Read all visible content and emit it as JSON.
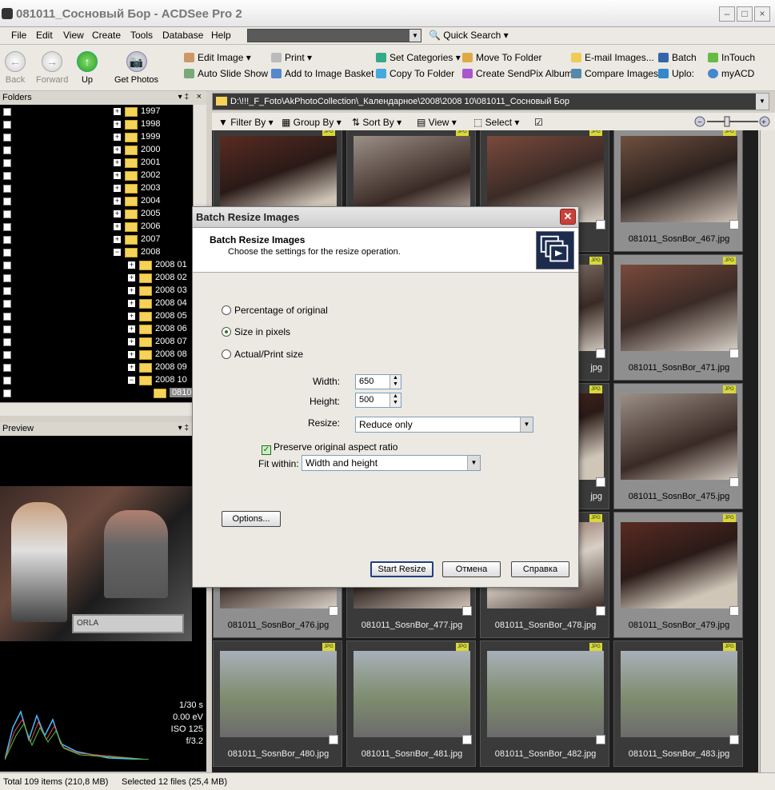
{
  "window": {
    "title": "081011_Сосновый Бор - ACDSee Pro 2"
  },
  "menu": [
    "File",
    "Edit",
    "View",
    "Create",
    "Tools",
    "Database",
    "Help"
  ],
  "quick_search": "Quick Search",
  "toolbar": {
    "back": "Back",
    "forward": "Forward",
    "up": "Up",
    "get_photos": "Get Photos",
    "edit_image": "Edit Image",
    "auto_slide_show": "Auto Slide Show",
    "print": "Print",
    "add_to_basket": "Add to Image Basket",
    "set_categories": "Set Categories",
    "copy_to_folder": "Copy To Folder",
    "move_to_folder": "Move To Folder",
    "sendpix": "Create SendPix Album",
    "email_images": "E-mail Images...",
    "compare_images": "Compare Images",
    "batch": "Batch",
    "upload": "Uplo:",
    "intouch": "InTouch",
    "myacd": "myACD"
  },
  "folders_panel": {
    "title": "Folders",
    "items": [
      {
        "label": "1997",
        "level": 0
      },
      {
        "label": "1998",
        "level": 0
      },
      {
        "label": "1999",
        "level": 0
      },
      {
        "label": "2000",
        "level": 0
      },
      {
        "label": "2001",
        "level": 0
      },
      {
        "label": "2002",
        "level": 0
      },
      {
        "label": "2003",
        "level": 0
      },
      {
        "label": "2004",
        "level": 0
      },
      {
        "label": "2005",
        "level": 0
      },
      {
        "label": "2006",
        "level": 0
      },
      {
        "label": "2007",
        "level": 0
      },
      {
        "label": "2008",
        "level": 0,
        "expanded": true
      },
      {
        "label": "2008 01",
        "level": 1
      },
      {
        "label": "2008 02",
        "level": 1
      },
      {
        "label": "2008 03",
        "level": 1
      },
      {
        "label": "2008 04",
        "level": 1
      },
      {
        "label": "2008 05",
        "level": 1
      },
      {
        "label": "2008 06",
        "level": 1
      },
      {
        "label": "2008 07",
        "level": 1
      },
      {
        "label": "2008 08",
        "level": 1
      },
      {
        "label": "2008 09",
        "level": 1
      },
      {
        "label": "2008 10",
        "level": 1,
        "expanded": true
      },
      {
        "label": "0810",
        "level": 2,
        "selected": true
      }
    ]
  },
  "preview_panel": {
    "title": "Preview",
    "keyboard_label": "ORLA",
    "exif": [
      "1/30 s",
      "0.00 eV",
      "ISO 125",
      "f/3.2"
    ]
  },
  "path": "D:\\!!!_F_Foto\\AkPhotoCollection\\_Календарное\\2008\\2008 10\\081011_Сосновый Бор",
  "subtoolbar": {
    "filter_by": "Filter By",
    "group_by": "Group By",
    "sort_by": "Sort By",
    "view": "View",
    "select": "Select"
  },
  "thumbnails": [
    {
      "caption": "",
      "selected": false
    },
    {
      "caption": "",
      "selected": false
    },
    {
      "caption": "",
      "selected": false
    },
    {
      "caption": "081011_SosnBor_467.jpg",
      "selected": true
    },
    {
      "caption": "",
      "selected": false
    },
    {
      "caption": "",
      "selected": false
    },
    {
      "caption": "jpg",
      "selected": false
    },
    {
      "caption": "081011_SosnBor_471.jpg",
      "selected": true
    },
    {
      "caption": "",
      "selected": false
    },
    {
      "caption": "",
      "selected": false
    },
    {
      "caption": "jpg",
      "selected": false
    },
    {
      "caption": "081011_SosnBor_475.jpg",
      "selected": true
    },
    {
      "caption": "081011_SosnBor_476.jpg",
      "selected": true
    },
    {
      "caption": "081011_SosnBor_477.jpg",
      "selected": false
    },
    {
      "caption": "081011_SosnBor_478.jpg",
      "selected": false
    },
    {
      "caption": "081011_SosnBor_479.jpg",
      "selected": true
    },
    {
      "caption": "081011_SosnBor_480.jpg",
      "selected": false
    },
    {
      "caption": "081011_SosnBor_481.jpg",
      "selected": false
    },
    {
      "caption": "081011_SosnBor_482.jpg",
      "selected": false
    },
    {
      "caption": "081011_SosnBor_483.jpg",
      "selected": false
    }
  ],
  "status": {
    "total": "Total 109 items  (210,8 MB)",
    "selected": "Selected 12 files (25,4 MB)"
  },
  "dialog": {
    "title": "Batch Resize Images",
    "heading": "Batch Resize Images",
    "subheading": "Choose the settings for the resize operation.",
    "options": [
      {
        "label": "Percentage of original",
        "checked": false
      },
      {
        "label": "Size in pixels",
        "checked": true
      },
      {
        "label": "Actual/Print size",
        "checked": false
      }
    ],
    "width_label": "Width:",
    "width_value": "650",
    "height_label": "Height:",
    "height_value": "500",
    "resize_label": "Resize:",
    "resize_value": "Reduce only",
    "preserve_label": "Preserve original aspect ratio",
    "fit_label": "Fit within:",
    "fit_value": "Width and height",
    "options_btn": "Options...",
    "start_btn": "Start Resize",
    "cancel_btn": "Отмена",
    "help_btn": "Справка"
  }
}
